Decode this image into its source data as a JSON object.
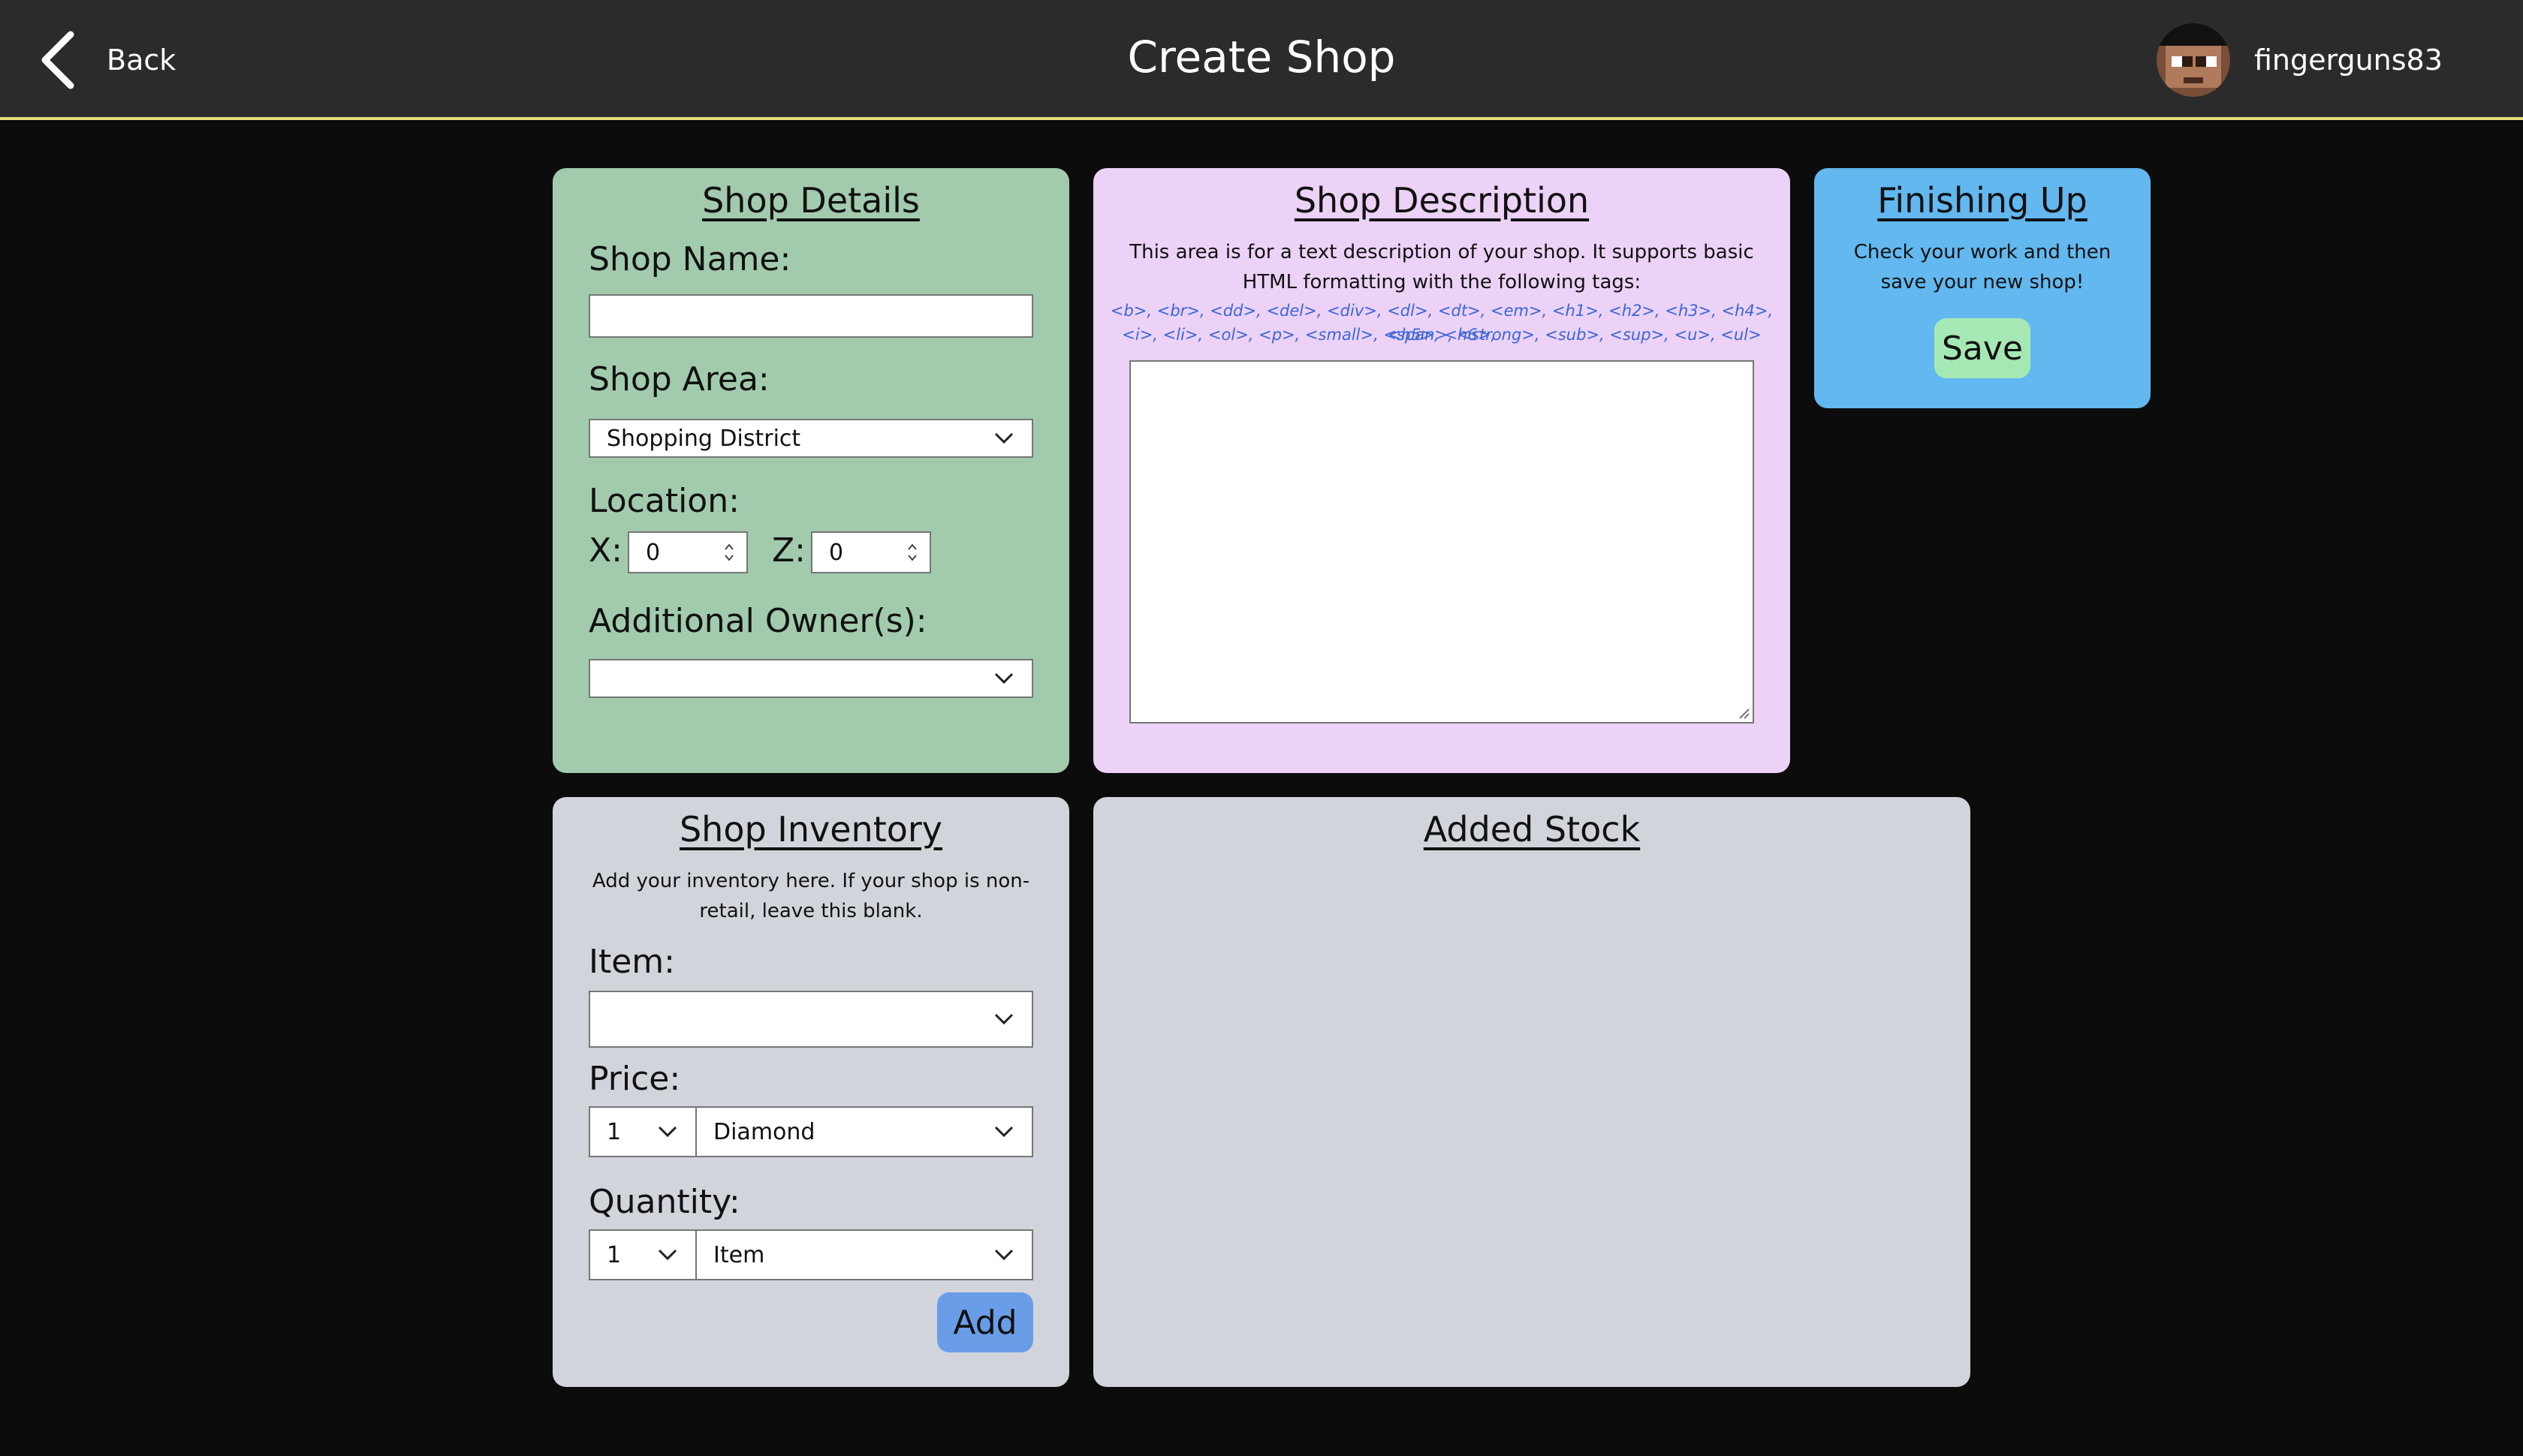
{
  "header": {
    "back_label": "Back",
    "title": "Create Shop",
    "username": "fingerguns83"
  },
  "shop_details": {
    "heading": "Shop Details",
    "name_label": "Shop Name:",
    "name_value": "",
    "area_label": "Shop Area:",
    "area_value": "Shopping District",
    "location_label": "Location:",
    "x_label": "X:",
    "x_value": "0",
    "z_label": "Z:",
    "z_value": "0",
    "owners_label": "Additional Owner(s):",
    "owners_value": ""
  },
  "shop_description": {
    "heading": "Shop Description",
    "help_text": "This area is for a text description of your shop. It supports basic HTML formatting with the following tags:",
    "tags_line1": "<b>, <br>, <dd>, <del>, <div>, <dl>, <dt>, <em>, <h1>, <h2>, <h3>, <h4>, <h5>, <h6>,",
    "tags_line2": "<i>, <li>, <ol>, <p>, <small>, <span>, <strong>, <sub>, <sup>, <u>, <ul>",
    "text_value": ""
  },
  "finishing_up": {
    "heading": "Finishing Up",
    "help_text": "Check your work and then save your new shop!",
    "save_label": "Save"
  },
  "shop_inventory": {
    "heading": "Shop Inventory",
    "help_text": "Add your inventory here. If your shop is non-retail, leave this blank.",
    "item_label": "Item:",
    "item_value": "",
    "price_label": "Price:",
    "price_amount": "1",
    "price_currency": "Diamond",
    "quantity_label": "Quantity:",
    "quantity_amount": "1",
    "quantity_unit": "Item",
    "add_label": "Add"
  },
  "added_stock": {
    "heading": "Added Stock"
  },
  "colors": {
    "header_bg": "#2b2b2b",
    "header_border": "#e6dc7a",
    "details_bg": "#a2cbad",
    "description_bg": "#ecd2f7",
    "finishing_bg": "#62b8ef",
    "inventory_bg": "#d1d5db",
    "save_button": "#a5e8b3",
    "add_button": "#6a9de8",
    "tag_text": "#3a66d8"
  }
}
